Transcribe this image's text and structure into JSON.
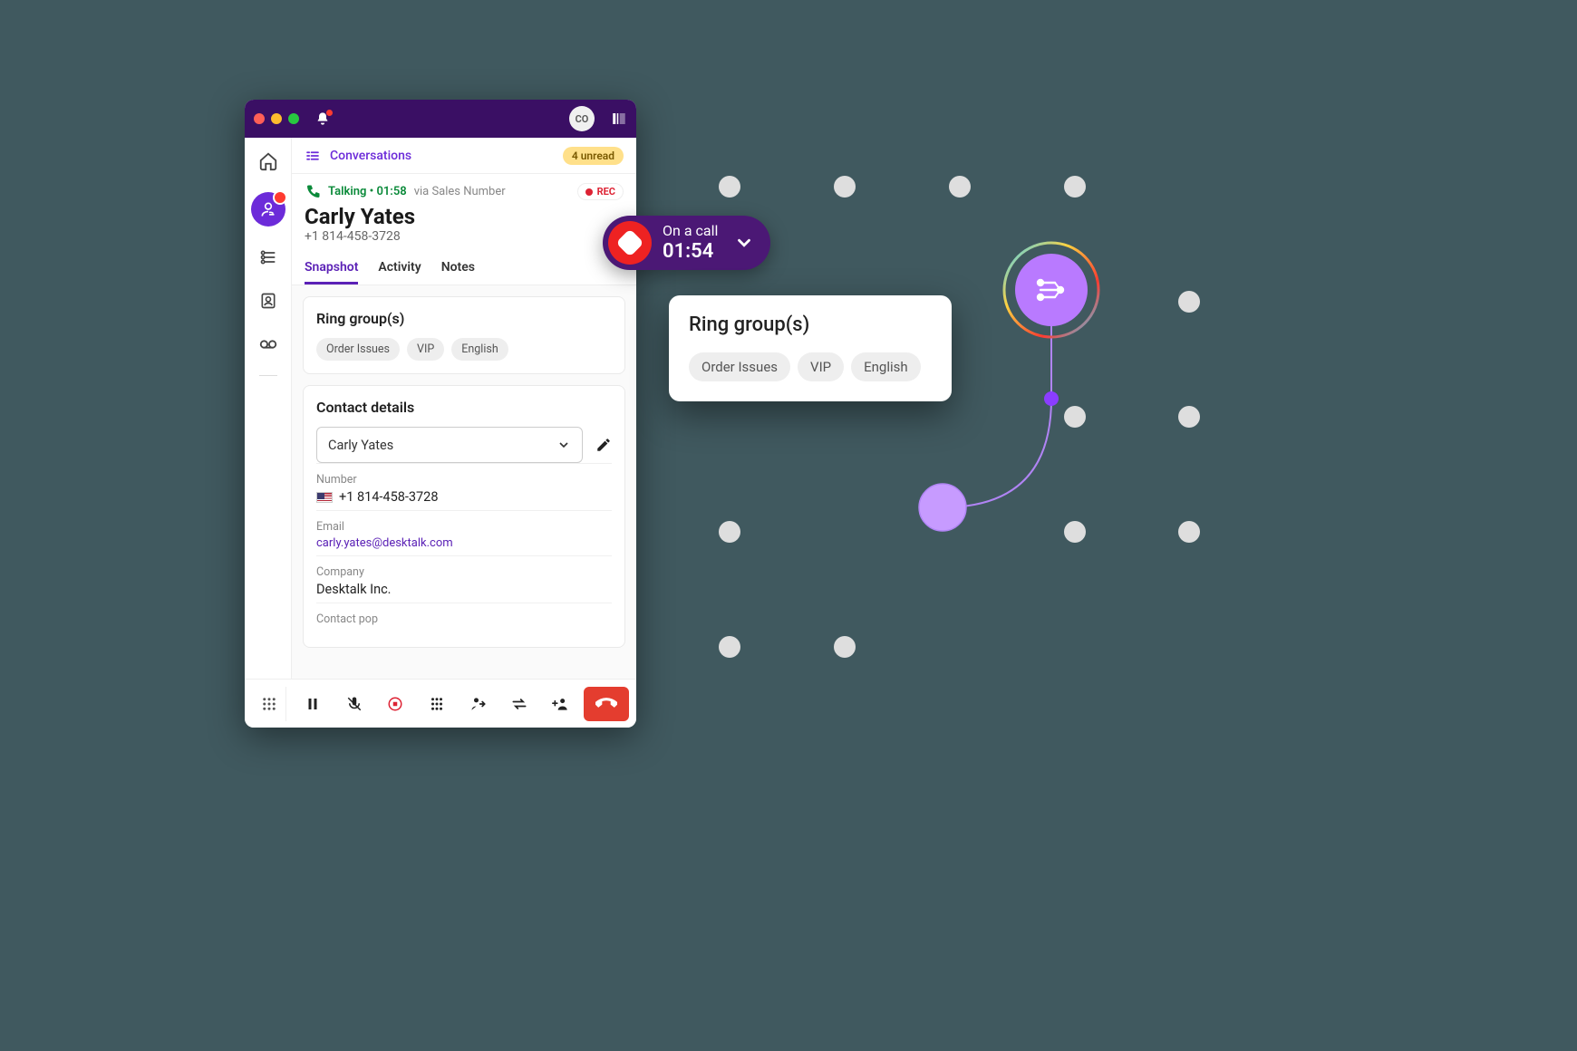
{
  "titlebar": {
    "avatar_initials": "CO"
  },
  "conversations": {
    "label": "Conversations",
    "unread": "4 unread"
  },
  "call": {
    "status": "Talking",
    "sep": " • ",
    "duration": "01:58",
    "via": "via Sales Number",
    "rec": "REC"
  },
  "contact": {
    "name": "Carly Yates",
    "phone": "+1 814-458-3728"
  },
  "tabs": [
    "Snapshot",
    "Activity",
    "Notes"
  ],
  "ring_groups": {
    "title": "Ring group(s)",
    "chips": [
      "Order Issues",
      "VIP",
      "English"
    ]
  },
  "details": {
    "title": "Contact details",
    "select_value": "Carly Yates",
    "fields": [
      {
        "label": "Number",
        "value": "+1 814-458-3728",
        "flag": true
      },
      {
        "label": "Email",
        "value": "carly.yates@desktalk.com",
        "link": true
      },
      {
        "label": "Company",
        "value": "Desktalk Inc."
      },
      {
        "label": "Contact pop",
        "value": ""
      }
    ]
  },
  "status_pill": {
    "line1": "On a call",
    "line2": "01:54"
  },
  "float_ring": {
    "title": "Ring group(s)",
    "chips": [
      "Order Issues",
      "VIP",
      "English"
    ]
  }
}
